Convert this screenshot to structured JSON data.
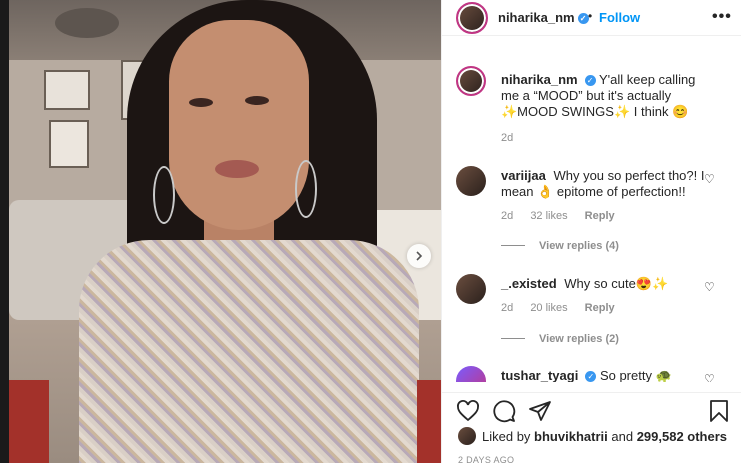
{
  "post": {
    "username": "niharika_nm",
    "follow_label": "Follow",
    "dot": "•",
    "more_label": "•••",
    "caption_text": "Y'all keep calling me a “MOOD” but it's actually ✨MOOD SWINGS✨ I think 😊",
    "caption_time": "2d"
  },
  "comments": [
    {
      "username": "variijaa",
      "text": "Why you so perfect tho?! I mean 👌 epitome of perfection!!",
      "time": "2d",
      "likes": "32 likes",
      "reply_label": "Reply",
      "view_replies": "View replies (4)"
    },
    {
      "username": "_.existed",
      "text": "Why so cute😍✨",
      "time": "2d",
      "likes": "20 likes",
      "reply_label": "Reply",
      "view_replies": "View replies (2)"
    },
    {
      "username": "tushar_tyagi",
      "text": "So pretty 🐢"
    }
  ],
  "likes": {
    "prefix": "Liked by",
    "user": "bhuvikhatrii",
    "middle": "and",
    "count": "299,582 others"
  },
  "timestamp": "2 DAYS AGO",
  "colors": {
    "accent_blue": "#0095f6",
    "verified_blue": "#3897f0",
    "muted": "#8e8e8e",
    "text": "#262626"
  },
  "icons": [
    "chevron-right-icon",
    "verified-icon",
    "heart-icon",
    "comment-icon",
    "share-icon",
    "bookmark-icon",
    "more-icon"
  ]
}
